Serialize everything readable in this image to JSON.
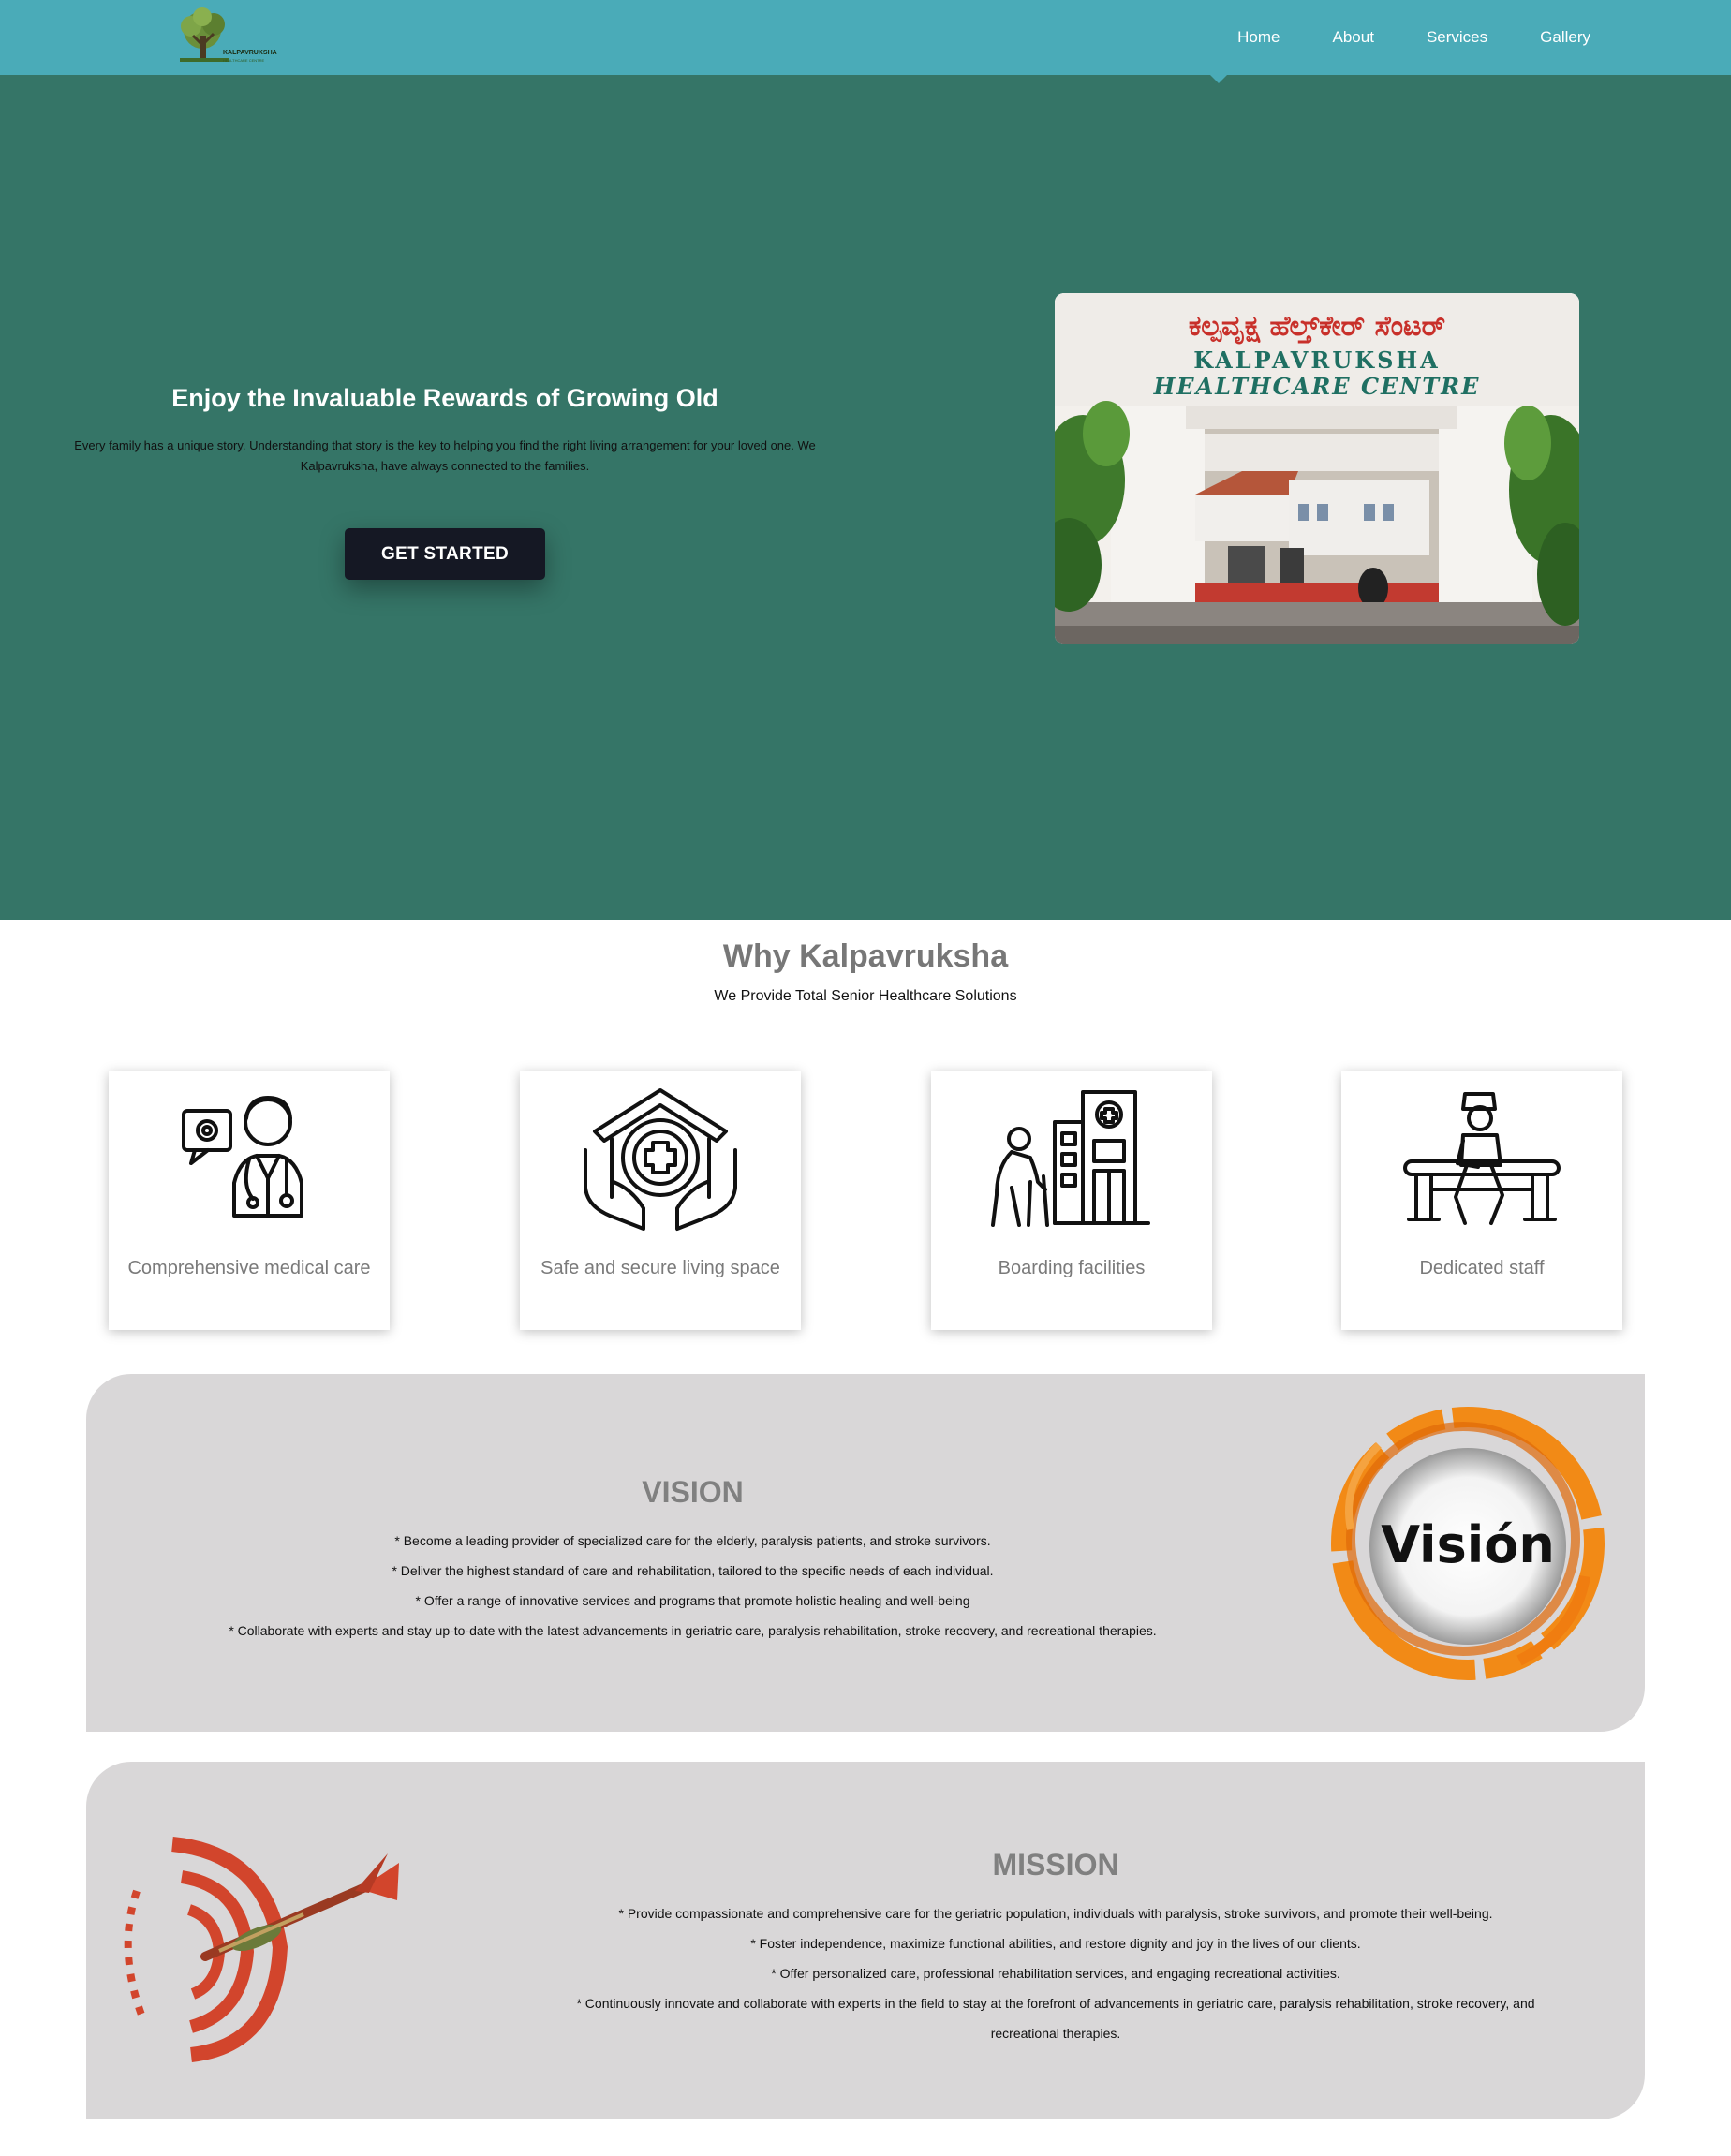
{
  "nav": {
    "links": [
      "Home",
      "About",
      "Services",
      "Gallery"
    ],
    "active": "Home"
  },
  "logo": {
    "brand": "KALPAVRUKSHA",
    "subtitle": "HEALTHCARE CENTRE"
  },
  "hero": {
    "title": "Enjoy the Invaluable Rewards of Growing Old",
    "text": "Every family has a unique story. Understanding that story is the key to helping you find the right living arrangement for your loved one. We Kalpavruksha, have always connected to the families.",
    "cta": "GET STARTED",
    "image_sign": {
      "kannada": "ಕಲ್ಪವೃಕ್ಷ ಹೆಲ್ತ್‌ಕೇರ್ ಸೆಂಟರ್",
      "line1": "KALPAVRUKSHA",
      "line2": "HEALTHCARE CENTRE"
    }
  },
  "why": {
    "title": "Why Kalpavruksha",
    "subtitle": "We Provide Total Senior Healthcare Solutions",
    "features": [
      {
        "label": "Comprehensive medical care",
        "icon": "doctor-icon"
      },
      {
        "label": "Safe and secure living space",
        "icon": "home-care-icon"
      },
      {
        "label": "Boarding facilities",
        "icon": "boarding-icon"
      },
      {
        "label": "Dedicated staff",
        "icon": "staff-icon"
      }
    ]
  },
  "vision": {
    "title": "VISION",
    "badge_text": "Visión",
    "points": [
      "* Become a leading provider of specialized care for the elderly, paralysis patients, and stroke survivors.",
      "* Deliver the highest standard of care and rehabilitation, tailored to the specific needs of each individual.",
      "* Offer a range of innovative services and programs that promote holistic healing and well-being",
      "* Collaborate with experts and stay up-to-date with the latest advancements in geriatric care, paralysis rehabilitation, stroke recovery, and recreational therapies."
    ]
  },
  "mission": {
    "title": "MISSION",
    "points": [
      "* Provide compassionate and comprehensive care for the geriatric population, individuals with paralysis, stroke survivors, and promote their well-being.",
      "* Foster independence, maximize functional abilities, and restore dignity and joy in the lives of our clients.",
      "* Offer personalized care, professional rehabilitation services, and engaging recreational activities.",
      "* Continuously innovate and collaborate with experts in the field to stay at the forefront of advancements in geriatric care, paralysis rehabilitation, stroke recovery, and",
      "recreational therapies."
    ]
  },
  "colors": {
    "nav": "#4aabb8",
    "hero": "#357567",
    "button": "#151824",
    "panel": "#d9d7d8",
    "vision_orange": "#f28a16",
    "dart_red": "#d2452c"
  }
}
